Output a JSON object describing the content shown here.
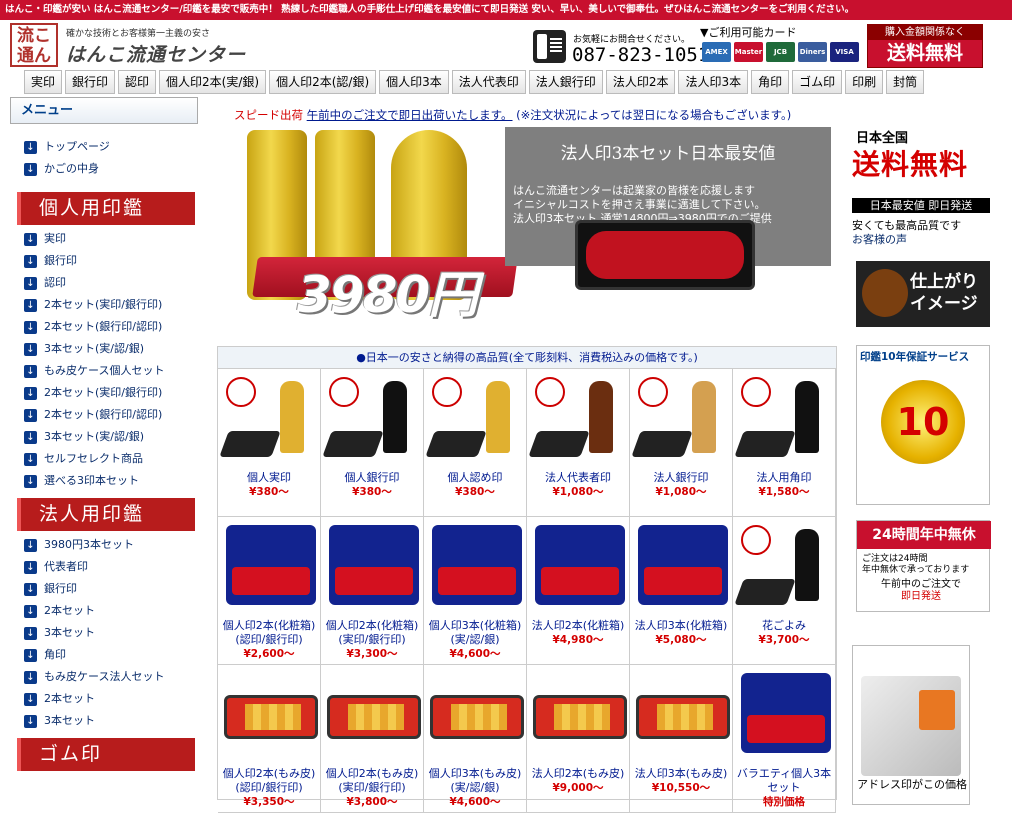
{
  "topbar": {
    "text": "はんこ・印鑑が安い はんこ流通センター/印鑑を最安で販売中！ 熟練した印鑑職人の手彫仕上げ印鑑を最安値にて即日発送 安い、早い、美しいで御奉仕。ぜひはんこ流通センターをご利用ください。"
  },
  "header": {
    "logo_text": "流こ 通ん",
    "tagline": "確かな技術とお客様第一主義の安さ",
    "site_name": "はんこ流通センター",
    "phone_note": "お気軽にお問合せください。",
    "phone_number": "087-823-1051",
    "card_title": "▼ご利用可能カード",
    "cards": [
      {
        "name": "AMEX",
        "color": "#2a6cb5"
      },
      {
        "name": "Master",
        "color": "#c8102e"
      },
      {
        "name": "JCB",
        "color": "#1f6a3a"
      },
      {
        "name": "Diners",
        "color": "#3a5d9e"
      },
      {
        "name": "VISA",
        "color": "#1a237e"
      }
    ],
    "free_small": "購入金額関係なく",
    "free_big": "送料無料"
  },
  "nav": [
    "実印",
    "銀行印",
    "認印",
    "個人印2本(実/銀)",
    "個人印2本(認/銀)",
    "個人印3本",
    "法人代表印",
    "法人銀行印",
    "法人印2本",
    "法人印3本",
    "角印",
    "ゴム印",
    "印刷",
    "封筒"
  ],
  "menu": {
    "head": "メニュー",
    "top_links": [
      "トップページ",
      "かごの中身"
    ],
    "personal_title": "個人用印鑑",
    "personal_links": [
      "実印",
      "銀行印",
      "認印",
      "2本セット(実印/銀行印)",
      "2本セット(銀行印/認印)",
      "3本セット(実/認/銀)",
      "もみ皮ケース個人セット",
      "2本セット(実印/銀行印)",
      "2本セット(銀行印/認印)",
      "3本セット(実/認/銀)",
      "セルフセレクト商品",
      "選べる3印本セット"
    ],
    "corporate_title": "法人用印鑑",
    "corporate_links": [
      "3980円3本セット",
      "代表者印",
      "銀行印",
      "2本セット",
      "3本セット",
      "角印",
      "もみ皮ケース法人セット",
      "2本セット",
      "3本セット"
    ],
    "rubber_title": "ゴム印"
  },
  "speed": {
    "red": "スピード出荷",
    "underlined": "午前中のご注文で即日出荷いたします。",
    "note": "(※注文状況によっては翌日になる場合もございます。)"
  },
  "hero": {
    "price": "3980円",
    "title": "法人印3本セット日本最安値",
    "text": "はんこ流通センターは起業家の皆様を応援します\nイニシャルコストを押さえ事業に邁進して下さい。\n法人印3本セット 通常14800円⇒3980円でのご提供"
  },
  "products": {
    "heading": "●日本一の安さと納得の高品質(全て彫刻料、消費税込みの価格です。)",
    "items": [
      {
        "name": "個人実印",
        "price": "¥380〜",
        "kind": "hanko",
        "color": "#e0b030"
      },
      {
        "name": "個人銀行印",
        "price": "¥380〜",
        "kind": "hanko",
        "color": "#111"
      },
      {
        "name": "個人認め印",
        "price": "¥380〜",
        "kind": "hanko",
        "color": "#e0b030"
      },
      {
        "name": "法人代表者印",
        "price": "¥1,080〜",
        "kind": "hanko",
        "color": "#6b2e10"
      },
      {
        "name": "法人銀行印",
        "price": "¥1,080〜",
        "kind": "hanko",
        "color": "#d4a050"
      },
      {
        "name": "法人用角印",
        "price": "¥1,580〜",
        "kind": "hanko",
        "color": "#111"
      },
      {
        "name": "個人印2本(化粧箱)(認印/銀行印)",
        "price": "¥2,600〜",
        "kind": "box",
        "color": ""
      },
      {
        "name": "個人印2本(化粧箱)(実印/銀行印)",
        "price": "¥3,300〜",
        "kind": "box",
        "color": ""
      },
      {
        "name": "個人印3本(化粧箱)(実/認/銀)",
        "price": "¥4,600〜",
        "kind": "box",
        "color": ""
      },
      {
        "name": "法人印2本(化粧箱)",
        "price": "¥4,980〜",
        "kind": "box",
        "color": ""
      },
      {
        "name": "法人印3本(化粧箱)",
        "price": "¥5,080〜",
        "kind": "box",
        "color": ""
      },
      {
        "name": "花ごよみ",
        "price": "¥3,700〜",
        "kind": "hanko",
        "color": "#111"
      },
      {
        "name": "個人印2本(もみ皮)(認印/銀行印)",
        "price": "¥3,350〜",
        "kind": "case",
        "color": ""
      },
      {
        "name": "個人印2本(もみ皮)(実印/銀行印)",
        "price": "¥3,800〜",
        "kind": "case",
        "color": ""
      },
      {
        "name": "個人印3本(もみ皮)(実/認/銀)",
        "price": "¥4,600〜",
        "kind": "case",
        "color": ""
      },
      {
        "name": "法人印2本(もみ皮)",
        "price": "¥9,000〜",
        "kind": "case",
        "color": ""
      },
      {
        "name": "法人印3本(もみ皮)",
        "price": "¥10,550〜",
        "kind": "case",
        "color": ""
      },
      {
        "name": "バラエティ個人3本セット",
        "price": "特別価格",
        "kind": "box",
        "color": ""
      }
    ]
  },
  "right": {
    "r1_title": "日本全国",
    "r1_big": "送料無料",
    "r1_bar": "日本最安値 即日発送",
    "r1_line1": "安くても最高品質です",
    "r1_line2": "お客様の声",
    "r2": "仕上がりイメージ",
    "r3_title": "印鑑10年保証サービス",
    "r3_num": "10",
    "r4_title": "24時間年中無休",
    "r4_a": "ご注文は24時間\n年中無休で承っております",
    "r4_b1": "午前中のご注文で",
    "r4_b2": "即日発送",
    "r5": "アドレス印がこの価格"
  }
}
